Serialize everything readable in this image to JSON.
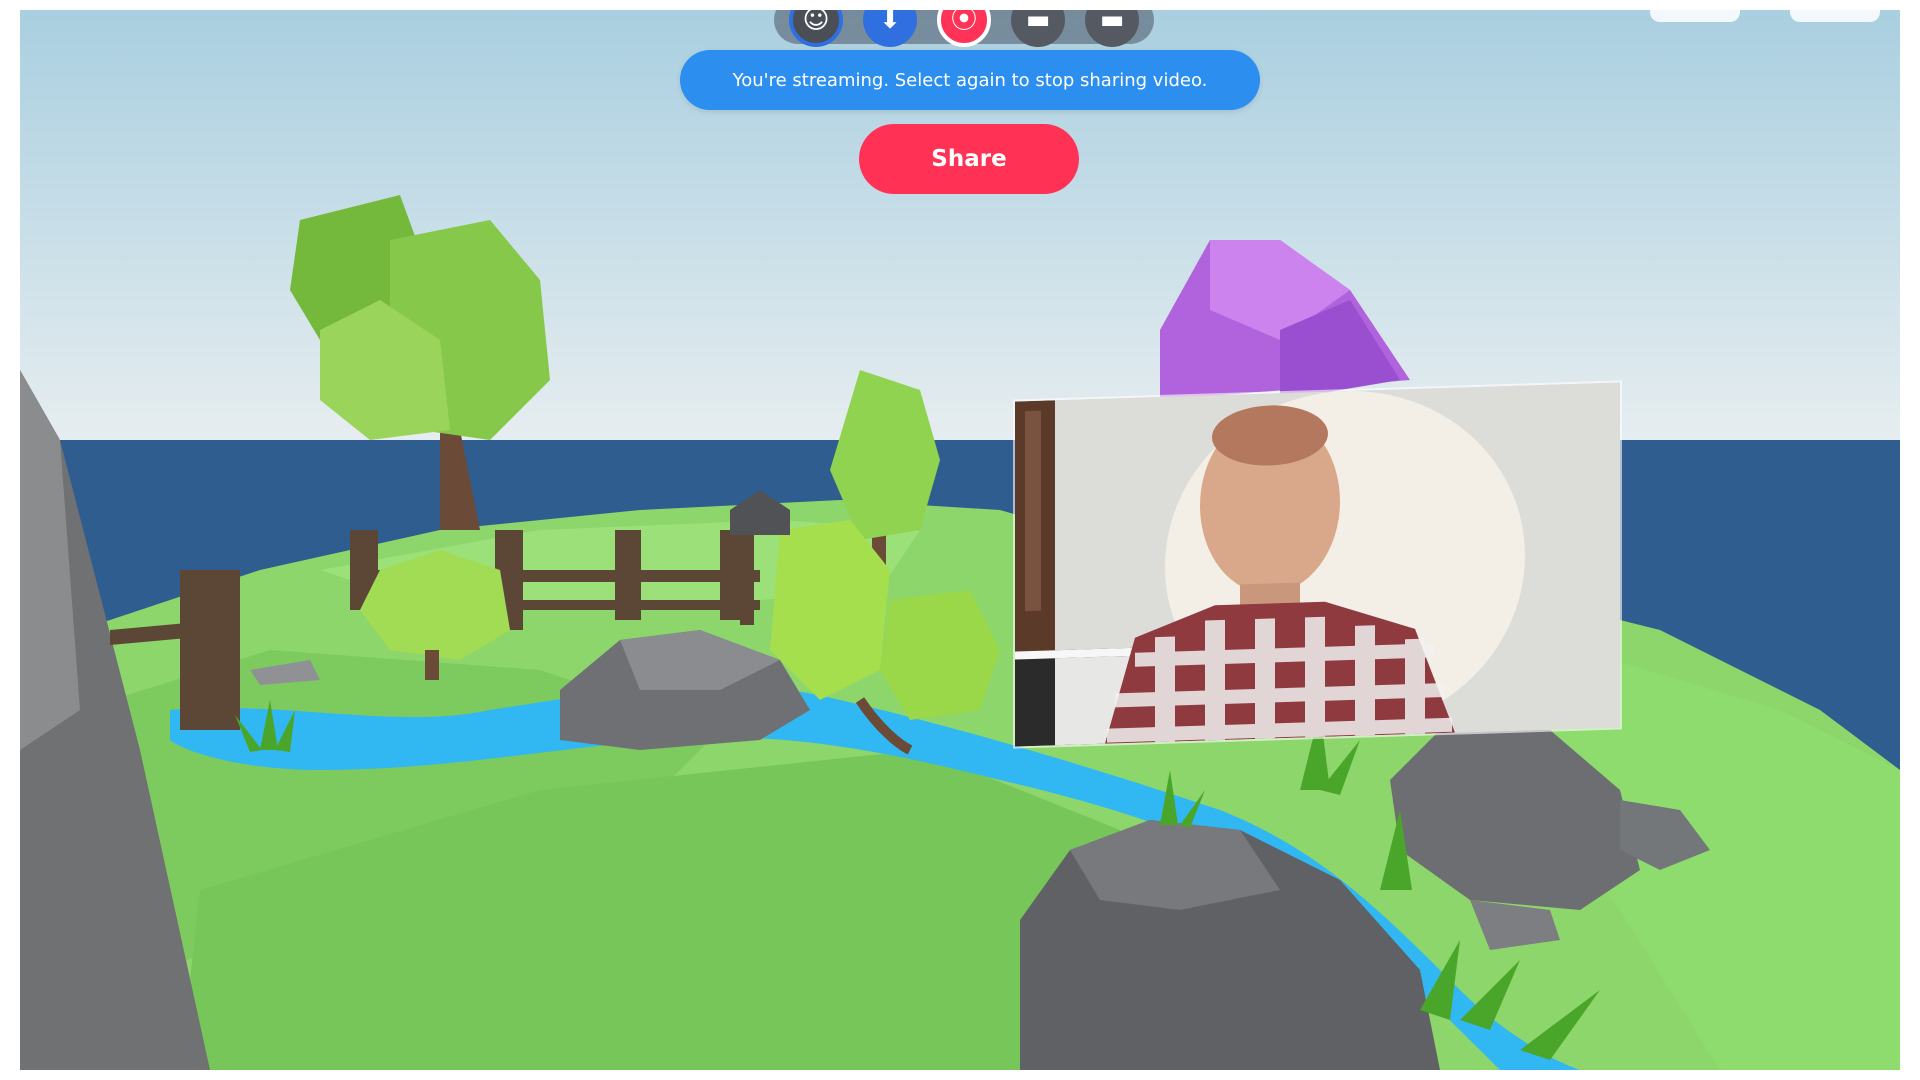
{
  "app": {
    "accent": "#2c8ff0",
    "share_color": "#ff3255"
  },
  "toolbar": {
    "items": [
      {
        "icon": "avatar-icon",
        "glyph": "☺"
      },
      {
        "icon": "voice-icon",
        "glyph": "⬇"
      },
      {
        "icon": "camera-icon",
        "glyph": "⦿"
      },
      {
        "icon": "media-icon",
        "glyph": "▬"
      },
      {
        "icon": "more-icon",
        "glyph": "▬"
      }
    ]
  },
  "toast": {
    "message": "You're streaming. Select again to stop sharing video."
  },
  "share": {
    "label": "Share"
  }
}
